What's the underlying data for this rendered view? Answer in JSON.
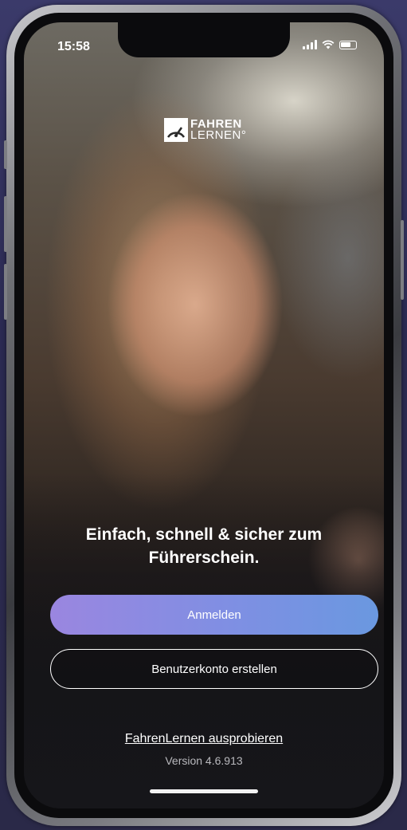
{
  "status_bar": {
    "time": "15:58",
    "icons": [
      "cellular-signal-icon",
      "wifi-icon",
      "battery-icon"
    ]
  },
  "logo": {
    "line1": "FAHREN",
    "line2": "LERNEN°"
  },
  "headline": "Einfach, schnell & sicher zum Führerschein.",
  "buttons": {
    "login": "Anmelden",
    "register": "Benutzerkonto erstellen"
  },
  "try_link": "FahrenLernen ausprobieren",
  "version": "Version 4.6.913",
  "colors": {
    "primary_button_start": "#9a86e0",
    "primary_button_end": "#6a98e0",
    "text": "#ffffff",
    "version_text": "#b9b9bd"
  }
}
